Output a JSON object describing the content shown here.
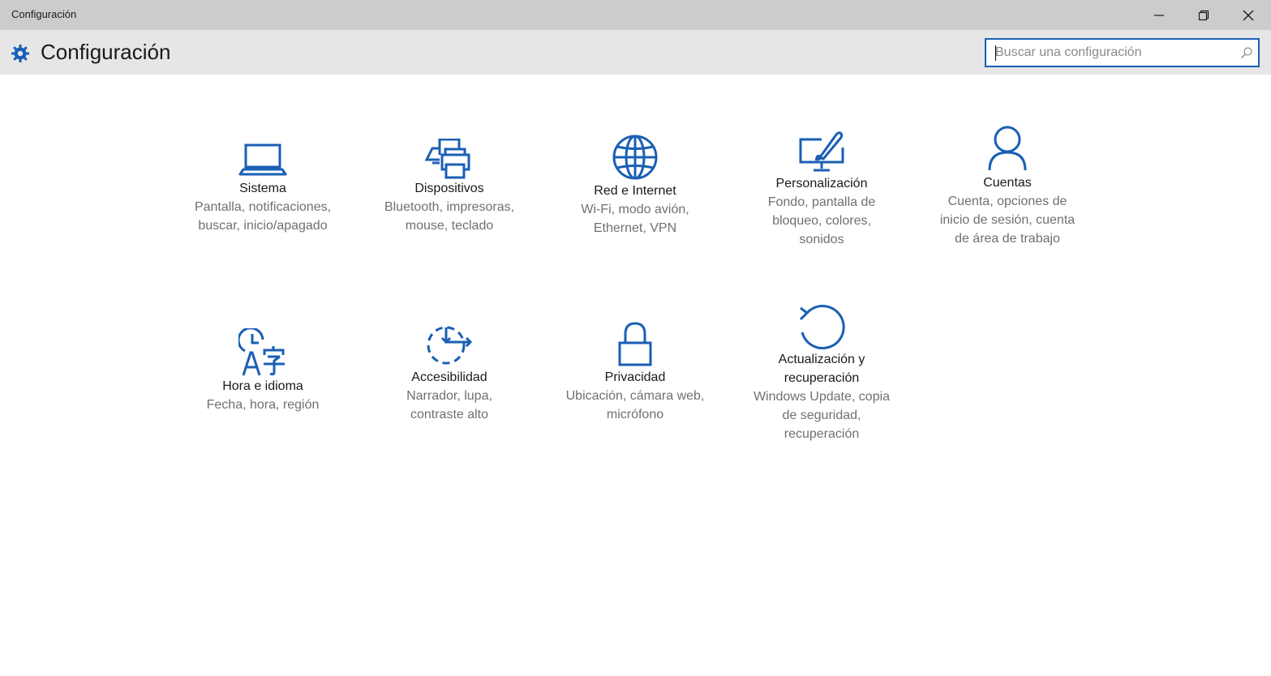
{
  "window": {
    "title": "Configuración",
    "controls": [
      "minimize",
      "restore",
      "close"
    ]
  },
  "header": {
    "title": "Configuración",
    "icon": "gear-icon"
  },
  "search": {
    "placeholder": "Buscar una configuración",
    "icon": "search-icon"
  },
  "colors": {
    "accent": "#1a5fb4",
    "titlebar": "#cccccc",
    "header": "#e6e6e6",
    "description": "#707070"
  },
  "tiles": [
    {
      "title": "Sistema",
      "description": "Pantalla, notificaciones,\nbuscar, inicio/apagado",
      "icon": "laptop-icon"
    },
    {
      "title": "Dispositivos",
      "description": "Bluetooth, impresoras,\nmouse, teclado",
      "icon": "devices-icon"
    },
    {
      "title": "Red e Internet",
      "description": "Wi-Fi, modo avión,\nEthernet, VPN",
      "icon": "globe-icon"
    },
    {
      "title": "Personalización",
      "description": "Fondo, pantalla de\nbloqueo, colores,\nsonidos",
      "icon": "personalization-icon"
    },
    {
      "title": "Cuentas",
      "description": "Cuenta, opciones de\ninicio de sesión, cuenta\nde área de trabajo",
      "icon": "person-icon"
    },
    {
      "title": "Hora e idioma",
      "description": "Fecha, hora, región",
      "icon": "time-language-icon"
    },
    {
      "title": "Accesibilidad",
      "description": "Narrador, lupa,\ncontraste alto",
      "icon": "accessibility-icon"
    },
    {
      "title": "Privacidad",
      "description": "Ubicación, cámara web,\nmicrófono",
      "icon": "lock-icon"
    },
    {
      "title": "Actualización y\nrecuperación",
      "description": "Windows Update, copia\nde seguridad,\nrecuperación",
      "icon": "update-icon"
    }
  ]
}
